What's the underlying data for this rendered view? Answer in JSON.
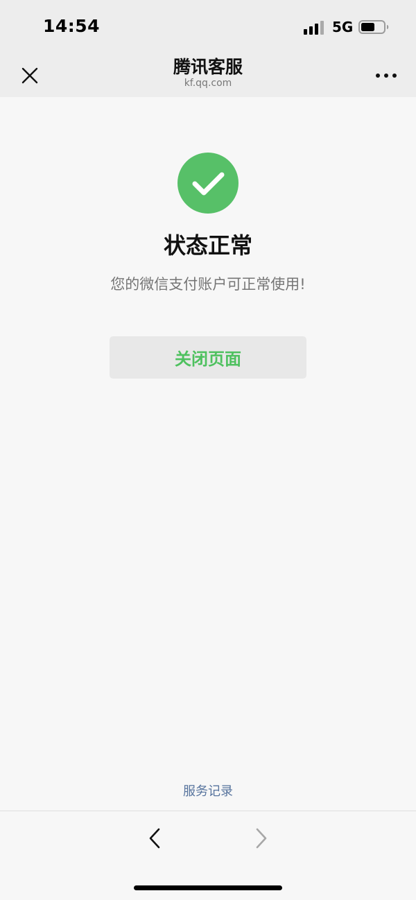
{
  "status_bar": {
    "time": "14:54",
    "network": "5G",
    "icons": [
      "signal-icon",
      "battery-icon"
    ]
  },
  "header": {
    "title": "腾讯客服",
    "subtitle": "kf.qq.com",
    "close_icon": "close-icon",
    "more_icon": "more-icon"
  },
  "result": {
    "icon": "check-circle-icon",
    "title": "状态正常",
    "description": "您的微信支付账户可正常使用!",
    "action_label": "关闭页面"
  },
  "footer": {
    "service_record_label": "服务记录",
    "back_icon": "chevron-left-icon",
    "forward_icon": "chevron-right-icon"
  },
  "colors": {
    "success_green": "#57c068",
    "action_text": "#4ec15f",
    "link_blue": "#56739d"
  }
}
